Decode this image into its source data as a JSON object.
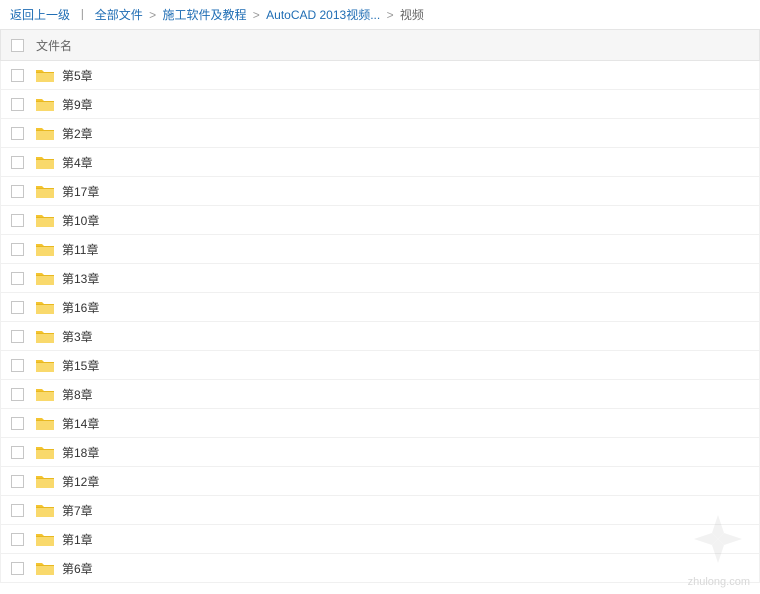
{
  "breadcrumb": {
    "back": "返回上一级",
    "divider": "丨",
    "items": [
      {
        "label": "全部文件",
        "link": true
      },
      {
        "label": "施工软件及教程",
        "link": true
      },
      {
        "label": "AutoCAD 2013视频...",
        "link": true
      },
      {
        "label": "视频",
        "link": false
      }
    ],
    "sep": ">"
  },
  "header": {
    "name": "文件名"
  },
  "files": [
    {
      "name": "第5章"
    },
    {
      "name": "第9章"
    },
    {
      "name": "第2章"
    },
    {
      "name": "第4章"
    },
    {
      "name": "第17章"
    },
    {
      "name": "第10章"
    },
    {
      "name": "第11章"
    },
    {
      "name": "第13章"
    },
    {
      "name": "第16章"
    },
    {
      "name": "第3章"
    },
    {
      "name": "第15章"
    },
    {
      "name": "第8章"
    },
    {
      "name": "第14章"
    },
    {
      "name": "第18章"
    },
    {
      "name": "第12章"
    },
    {
      "name": "第7章"
    },
    {
      "name": "第1章"
    },
    {
      "name": "第6章"
    }
  ],
  "watermark": "zhulong.com"
}
